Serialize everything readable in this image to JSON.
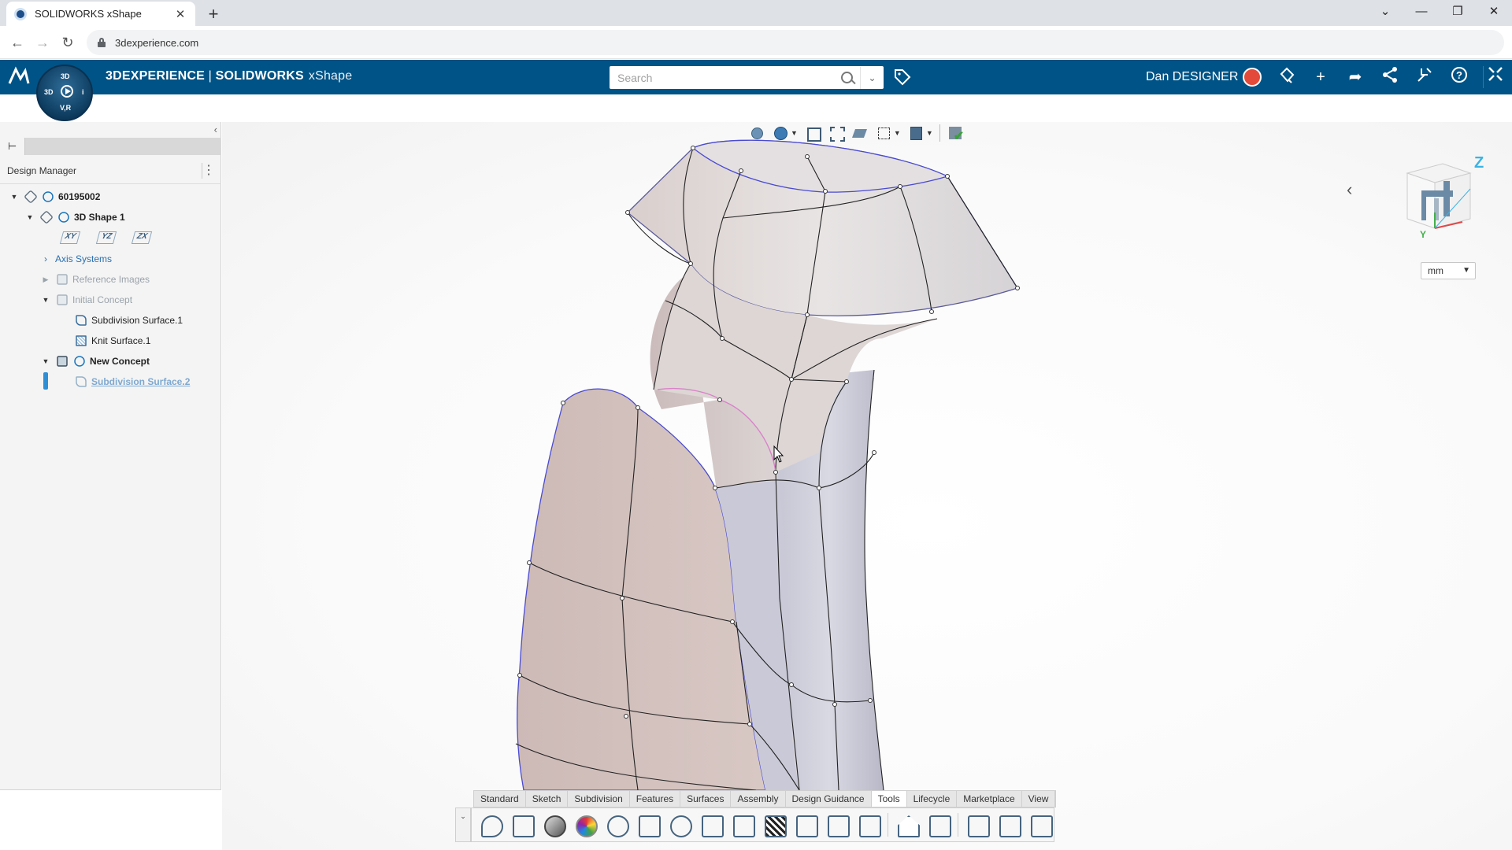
{
  "browser": {
    "tab_title": "SOLIDWORKS xShape",
    "tab_close": "✕",
    "new_tab": "+",
    "url": "3dexperience.com",
    "window_controls": [
      "⌄",
      "—",
      "❐",
      "✕"
    ]
  },
  "topbar": {
    "brand_bold": "3DEXPERIENCE",
    "brand_sep": " | ",
    "product_bold": "SOLIDWORKS",
    "product_name": "xShape",
    "search_placeholder": "Search",
    "user_name": "Dan DESIGNER",
    "compass": {
      "top": "3D",
      "left": "3D",
      "right": "i",
      "bottom": "V,R"
    }
  },
  "design_manager": {
    "header": "Design Manager",
    "tree": [
      {
        "label": "60195002",
        "expanded": true
      },
      {
        "label": "3D Shape 1",
        "expanded": true
      },
      {
        "planes": [
          "XY",
          "YZ",
          "ZX"
        ]
      },
      {
        "label": "Axis Systems",
        "expanded": false
      },
      {
        "label": "Reference Images",
        "expanded": false
      },
      {
        "label": "Initial Concept",
        "expanded": true
      },
      {
        "label": "Subdivision Surface.1"
      },
      {
        "label": "Knit Surface.1"
      },
      {
        "label": "New Concept",
        "expanded": true
      },
      {
        "label": "Subdivision Surface.2",
        "selected": true
      }
    ]
  },
  "viewport": {
    "unit": "mm",
    "axis_label": "Z",
    "axis_y": "Y"
  },
  "action_bar": {
    "tabs": [
      "Standard",
      "Sketch",
      "Subdivision",
      "Features",
      "Surfaces",
      "Assembly",
      "Design Guidance",
      "Tools",
      "Lifecycle",
      "Marketplace",
      "View"
    ],
    "active_tab": "Tools"
  }
}
